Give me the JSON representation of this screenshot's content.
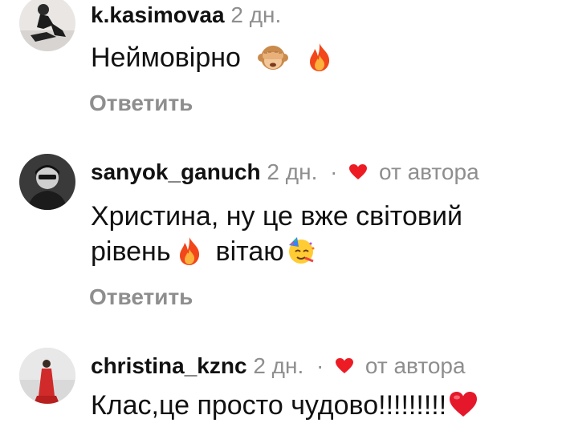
{
  "comments": [
    {
      "username": "k.kasimovaa",
      "time": "2 дн.",
      "author_like": "",
      "lines": [
        "Неймовірно"
      ],
      "emojis": [
        "see-no-evil-monkey-emoji",
        "fire-emoji"
      ],
      "reply_label": "Ответить"
    },
    {
      "username": "sanyok_ganuch",
      "time": "2 дн.",
      "separator": "·",
      "author_like": "от автора",
      "lines": [
        "Христина, ну це вже світовий",
        "рівень",
        "вітаю"
      ],
      "emojis": [
        "fire-emoji",
        "partying-face-emoji"
      ],
      "reply_label": "Ответить"
    },
    {
      "username": "christina_kznc",
      "time": "2 дн.",
      "separator": "·",
      "author_like": "от автора",
      "lines": [
        "Клас,це просто чудово!!!!!!!!!"
      ],
      "emojis": [
        "red-heart-emoji"
      ]
    }
  ],
  "colors": {
    "text": "#111111",
    "muted": "#8e8e8e",
    "heart": "#ed1c24"
  }
}
